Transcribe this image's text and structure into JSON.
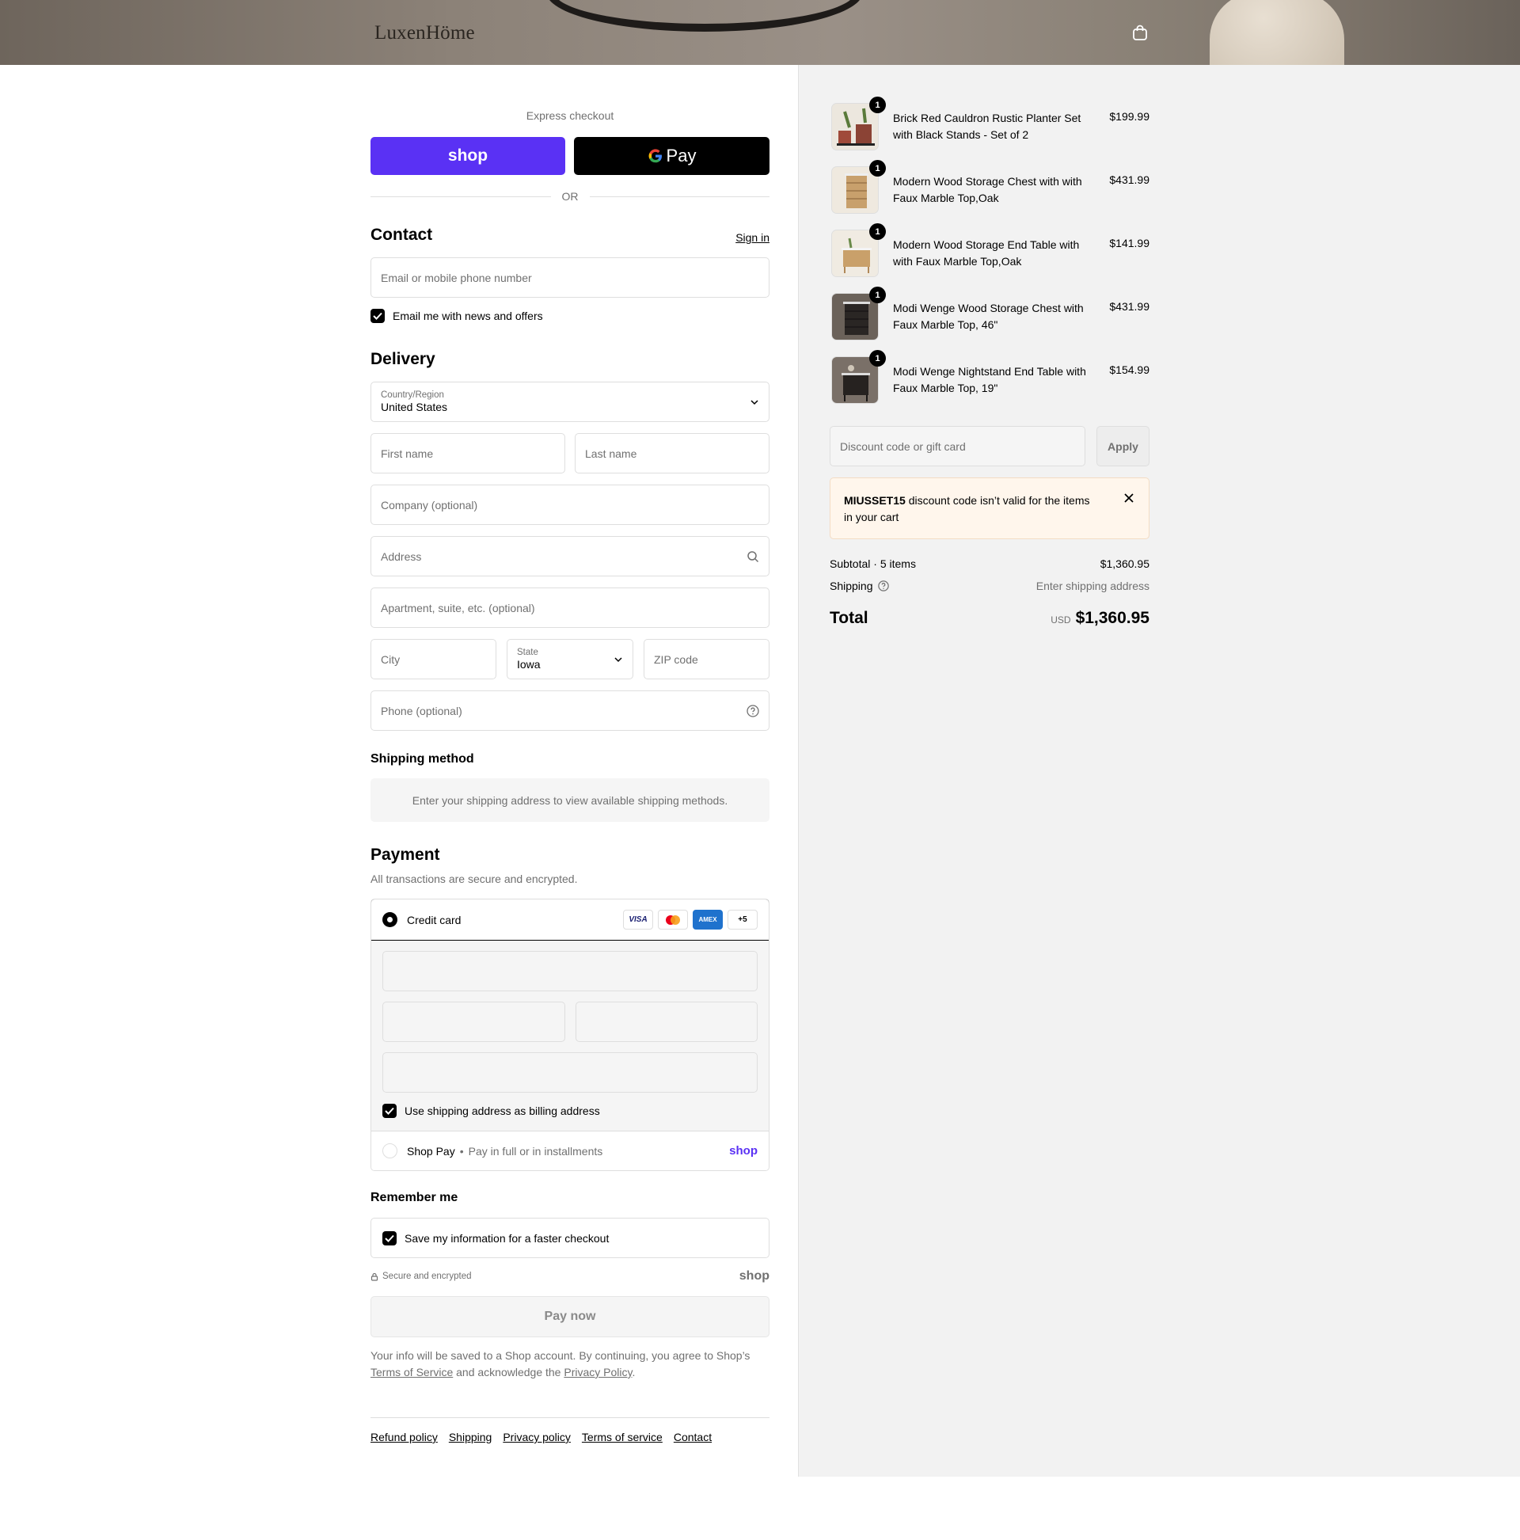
{
  "header": {
    "logo": "LuxenHöme"
  },
  "express": {
    "label": "Express checkout",
    "shop_label": "shop",
    "gpay_label": "Pay",
    "or_label": "OR"
  },
  "contact": {
    "title": "Contact",
    "sign_in": "Sign in",
    "email_placeholder": "Email or mobile phone number",
    "news_label": "Email me with news and offers"
  },
  "delivery": {
    "title": "Delivery",
    "country_label": "Country/Region",
    "country_value": "United States",
    "first_name": "First name",
    "last_name": "Last name",
    "company": "Company (optional)",
    "address": "Address",
    "apartment": "Apartment, suite, etc. (optional)",
    "city": "City",
    "state_label": "State",
    "state_value": "Iowa",
    "zip": "ZIP code",
    "phone": "Phone (optional)"
  },
  "shipping_method": {
    "title": "Shipping method",
    "info": "Enter your shipping address to view available shipping methods."
  },
  "payment": {
    "title": "Payment",
    "subtitle": "All transactions are secure and encrypted.",
    "credit_card": "Credit card",
    "cards": [
      "VISA",
      "AMEX",
      "+5"
    ],
    "billing_label": "Use shipping address as billing address",
    "shop_pay": "Shop Pay",
    "shop_pay_sub": "Pay in full or in installments",
    "shop_word": "shop"
  },
  "remember": {
    "title": "Remember me",
    "save_label": "Save my information for a faster checkout",
    "secure": "Secure and encrypted",
    "shop_word": "shop"
  },
  "pay_now": "Pay now",
  "legal": {
    "text1": "Your info will be saved to a Shop account. By continuing, you agree to Shop’s",
    "tos": "Terms of Service",
    "text2": "and acknowledge the",
    "privacy": "Privacy Policy",
    "text3": "."
  },
  "footer_links": [
    "Refund policy",
    "Shipping",
    "Privacy policy",
    "Terms of service",
    "Contact"
  ],
  "order": {
    "items": [
      {
        "qty": "1",
        "name": "Brick Red Cauldron Rustic Planter Set with Black Stands - Set of 2",
        "price": "$199.99"
      },
      {
        "qty": "1",
        "name": "Modern Wood Storage Chest with with Faux Marble Top,Oak",
        "price": "$431.99"
      },
      {
        "qty": "1",
        "name": "Modern Wood Storage End Table with with Faux Marble Top,Oak",
        "price": "$141.99"
      },
      {
        "qty": "1",
        "name": "Modi Wenge Wood Storage Chest with Faux Marble Top, 46\"",
        "price": "$431.99"
      },
      {
        "qty": "1",
        "name": "Modi Wenge Nightstand End Table with Faux Marble Top, 19\"",
        "price": "$154.99"
      }
    ],
    "discount_placeholder": "Discount code or gift card",
    "apply": "Apply",
    "notice_code": "MIUSSET15",
    "notice_text": "discount code isn’t valid for the items in your cart",
    "subtotal_label": "Subtotal · 5 items",
    "subtotal_value": "$1,360.95",
    "shipping_label": "Shipping",
    "shipping_value": "Enter shipping address",
    "total_label": "Total",
    "currency": "USD",
    "total_value": "$1,360.95"
  },
  "colors": {
    "shop_purple": "#5a31f4",
    "notice_bg": "#fff6ec"
  }
}
